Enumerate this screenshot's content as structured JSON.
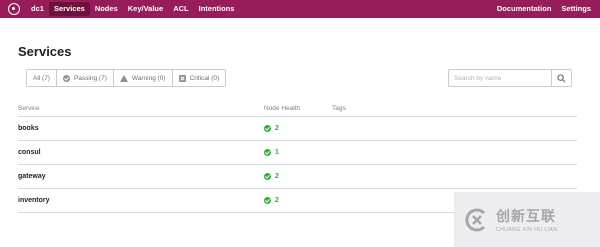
{
  "nav": {
    "datacenter": "dc1",
    "items": [
      {
        "label": "Services",
        "active": true
      },
      {
        "label": "Nodes",
        "active": false
      },
      {
        "label": "Key/Value",
        "active": false
      },
      {
        "label": "ACL",
        "active": false
      },
      {
        "label": "Intentions",
        "active": false
      }
    ],
    "right": [
      "Documentation",
      "Settings"
    ],
    "colors": {
      "bar": "#961d59",
      "active": "#6f0f3b"
    }
  },
  "page": {
    "title": "Services"
  },
  "filters": [
    {
      "label": "All (7)",
      "icon": "none"
    },
    {
      "label": "Passing (7)",
      "icon": "check-circle-icon"
    },
    {
      "label": "Warning (0)",
      "icon": "warning-triangle-icon"
    },
    {
      "label": "Critical (0)",
      "icon": "critical-x-icon"
    }
  ],
  "search": {
    "placeholder": "Search by name",
    "value": ""
  },
  "table": {
    "columns": [
      "Service",
      "Node Health",
      "Tags"
    ],
    "rows": [
      {
        "service": "books",
        "health": "2",
        "tags": ""
      },
      {
        "service": "consul",
        "health": "1",
        "tags": ""
      },
      {
        "service": "gateway",
        "health": "2",
        "tags": ""
      },
      {
        "service": "inventory",
        "health": "2",
        "tags": ""
      }
    ],
    "passing_color": "#2eb039"
  },
  "watermark": {
    "cn": "创新互联",
    "en": "CHUANG XIN HU LIAN"
  }
}
